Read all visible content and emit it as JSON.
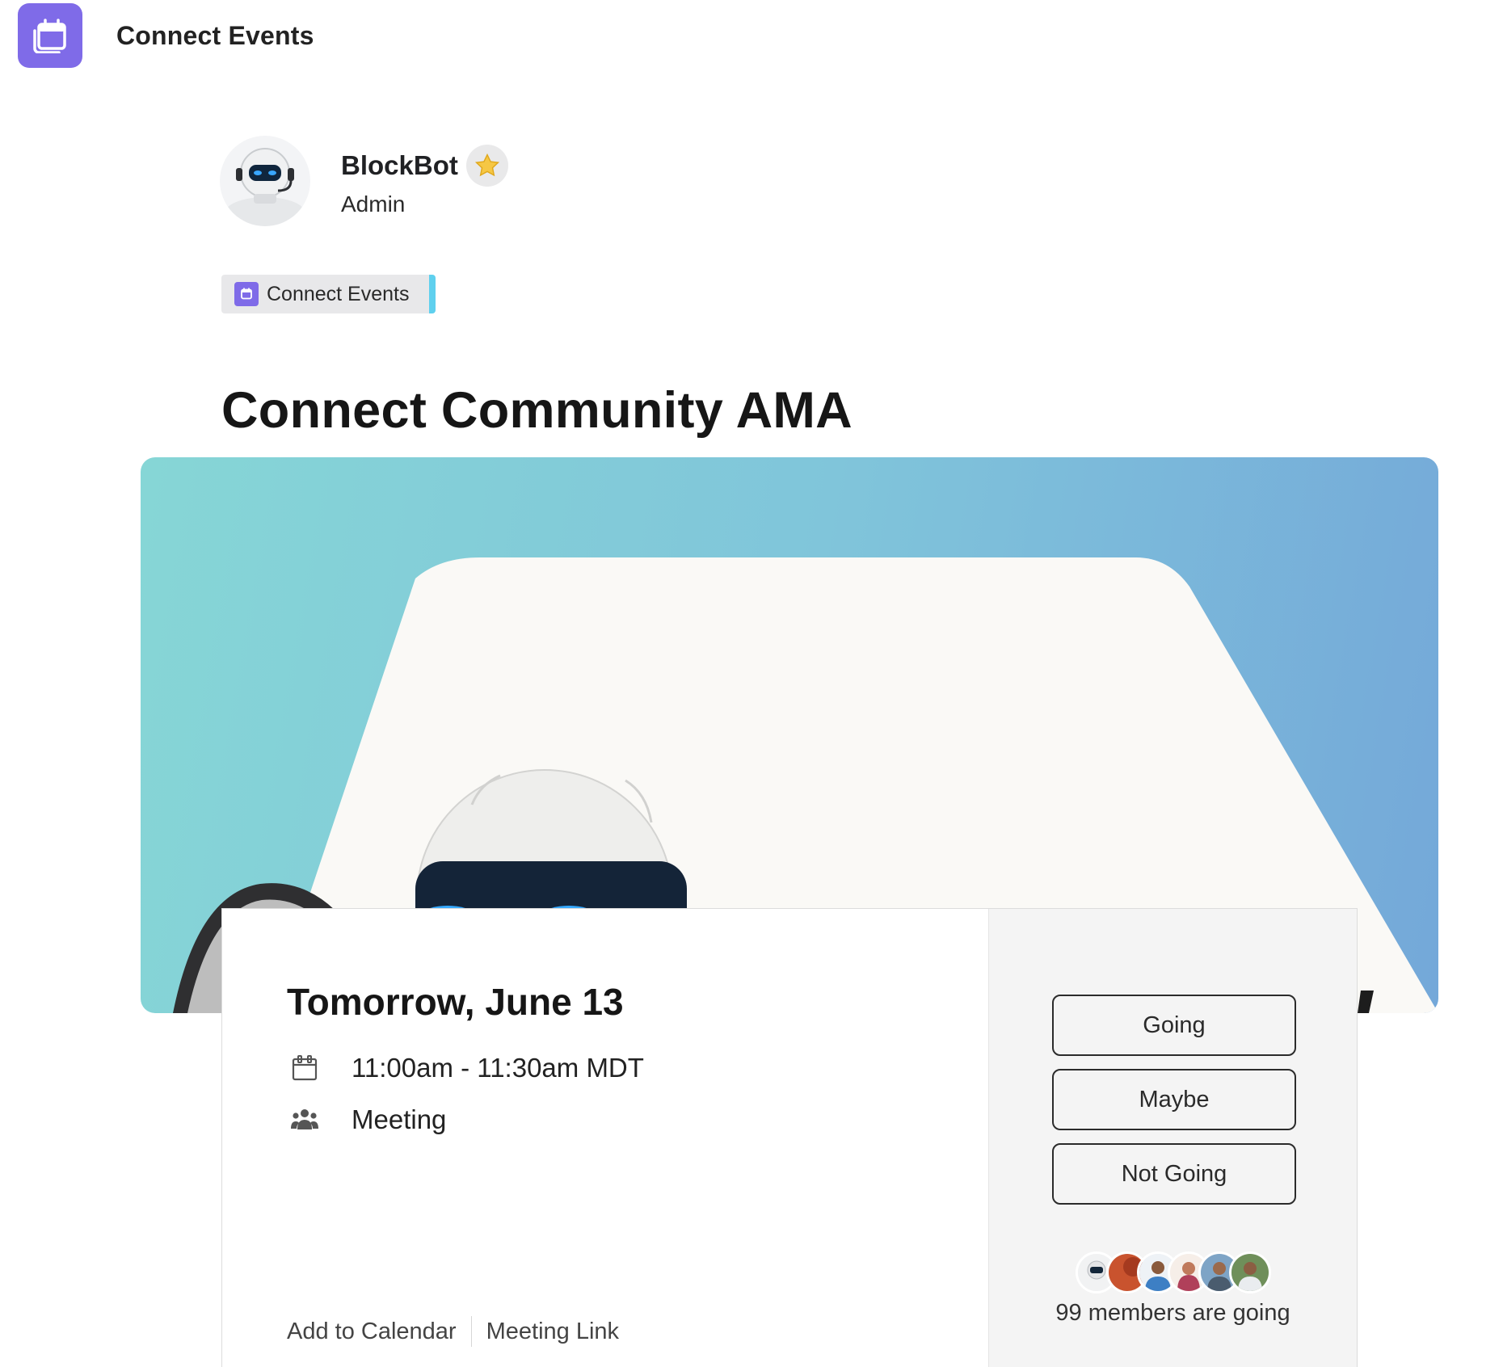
{
  "header": {
    "app_title": "Connect Events",
    "app_icon": "calendar-icon"
  },
  "author": {
    "name": "BlockBot",
    "role": "Admin",
    "badge_icon": "star-icon"
  },
  "space": {
    "label": "Connect Events",
    "icon": "calendar-icon",
    "accent_color": "#5fd0ee"
  },
  "event": {
    "title": "Connect Community AMA",
    "date": "Tomorrow, June 13",
    "time": "11:00am - 11:30am MDT",
    "type": "Meeting",
    "time_icon": "calendar-icon",
    "type_icon": "people-group-icon"
  },
  "links": {
    "add_to_calendar": "Add to Calendar",
    "meeting_link": "Meeting Link"
  },
  "rsvp": {
    "going": "Going",
    "maybe": "Maybe",
    "not_going": "Not Going",
    "attendee_avatar_count": 6,
    "going_summary": "99 members are going"
  },
  "colors": {
    "brand": "#7f6be8",
    "hero_gradient_start": "#86d6d6",
    "hero_gradient_end": "#74a8d9"
  }
}
